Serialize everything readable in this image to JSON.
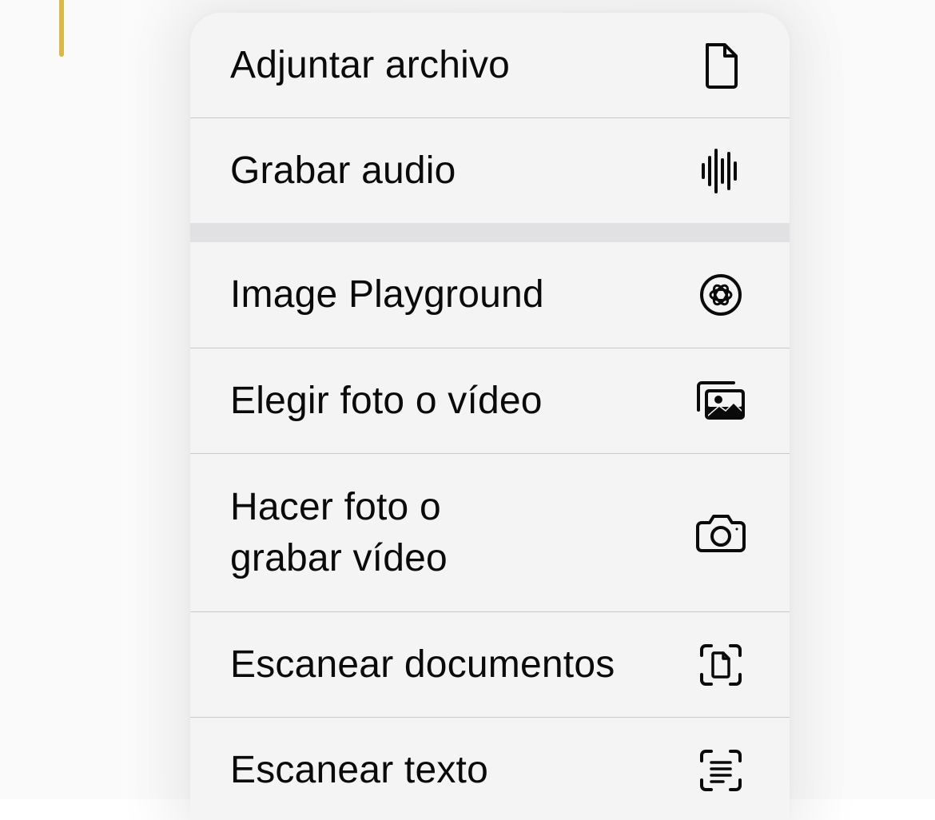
{
  "menu": {
    "items": [
      {
        "label": "Adjuntar archivo",
        "icon": "document-icon"
      },
      {
        "label": "Grabar audio",
        "icon": "waveform-icon"
      },
      {
        "label": "Image Playground",
        "icon": "image-playground-icon"
      },
      {
        "label": "Elegir foto o vídeo",
        "icon": "photo-library-icon"
      },
      {
        "label": "Hacer foto o\ngrabar vídeo",
        "icon": "camera-icon"
      },
      {
        "label": "Escanear documentos",
        "icon": "document-scan-icon"
      },
      {
        "label": "Escanear texto",
        "icon": "text-scan-icon"
      }
    ]
  },
  "colors": {
    "cursor": "#d9b94a",
    "menu_background": "#f4f4f4",
    "separator": "#c9c9cc",
    "group_gap": "#e1e1e3",
    "text": "#0a0a0a"
  }
}
